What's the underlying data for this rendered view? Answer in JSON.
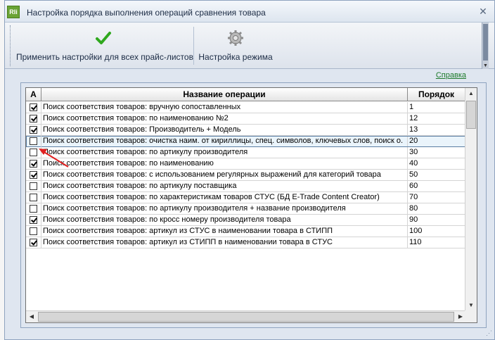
{
  "window": {
    "title": "Настройка порядка выполнения операций сравнения товара",
    "icon_text": "Rli",
    "close_icon": "close-icon"
  },
  "toolbar": {
    "apply_label": "Применить настройки для всех прайс-листов",
    "mode_label": "Настройка режима",
    "apply_icon": "green-check-icon",
    "mode_icon": "gear-icon"
  },
  "help": {
    "label": "Справка"
  },
  "grid": {
    "columns": {
      "a": "A",
      "name": "Название операции",
      "order": "Порядок"
    },
    "rows": [
      {
        "checked": true,
        "name": "Поиск соответствия товаров: вручную сопоставленных",
        "order": "1"
      },
      {
        "checked": true,
        "name": "Поиск соответствия товаров: по наименованию №2",
        "order": "12"
      },
      {
        "checked": true,
        "name": "Поиск соответствия товаров: Производитель + Модель",
        "order": "13"
      },
      {
        "checked": false,
        "name": "Поиск соответствия товаров: очистка наим. от кириллицы, спец. символов, ключевых слов, поиск о.",
        "order": "20",
        "selected": true
      },
      {
        "checked": false,
        "name": "Поиск соответствия товаров: по артикулу производителя",
        "order": "30"
      },
      {
        "checked": true,
        "name": "Поиск соответствия товаров: по наименованию",
        "order": "40"
      },
      {
        "checked": true,
        "name": "Поиск соответствия товаров: с использованием регулярных выражений для категорий товара",
        "order": "50"
      },
      {
        "checked": false,
        "name": "Поиск соответствия товаров: по артикулу поставщика",
        "order": "60"
      },
      {
        "checked": false,
        "name": "Поиск соответствия товаров: по характеристикам товаров СТУС (БД E-Trade Content Creator)",
        "order": "70"
      },
      {
        "checked": false,
        "name": "Поиск соответствия товаров: по артикулу производителя + название производителя",
        "order": "80"
      },
      {
        "checked": true,
        "name": "Поиск соответствия товаров: по кросс номеру производителя товара",
        "order": "90"
      },
      {
        "checked": false,
        "name": "Поиск соответствия товаров: артикул из СТУС в наименовании товара в СТИПП",
        "order": "100"
      },
      {
        "checked": true,
        "name": "Поиск соответствия товаров: артикул из СТИПП в наименовании товара в СТУС",
        "order": "110"
      }
    ]
  },
  "colors": {
    "accent_green": "#1d7a2b",
    "selection": "#eaf4fb",
    "annotation_arrow": "#e02020"
  }
}
